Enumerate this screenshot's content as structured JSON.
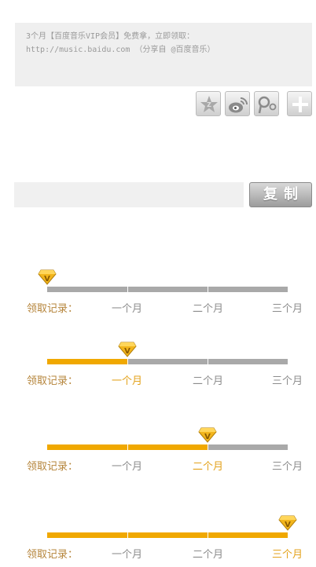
{
  "share": {
    "line1": "3个月【百度音乐VIP会员】免费拿，立即领取：",
    "line2": "http://music.baidu.com （分享自 @百度音乐）"
  },
  "share_icons": [
    "qzone-icon",
    "weibo-icon",
    "tencent-weibo-icon",
    "more-icon"
  ],
  "copy": {
    "input_value": "",
    "button_label": "复制"
  },
  "record_label": "领取记录：",
  "months": [
    "一个月",
    "二个月",
    "三个月"
  ],
  "progress_rows": [
    {
      "months_claimed": 0
    },
    {
      "months_claimed": 1
    },
    {
      "months_claimed": 2
    },
    {
      "months_claimed": 3
    }
  ],
  "colors": {
    "accent": "#f0a800",
    "track": "#a9a9a9",
    "label": "#b5843a",
    "active_month": "#e3a21b"
  }
}
